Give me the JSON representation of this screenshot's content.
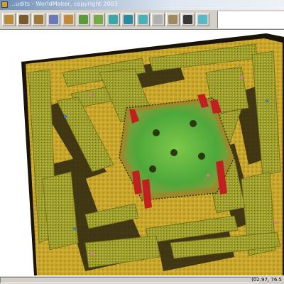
{
  "window": {
    "title": "...udits - WorldMaker, copyright 2003"
  },
  "toolbar": {
    "tools": [
      {
        "icon": "terrain-raise-icon",
        "color": "#b88a3a"
      },
      {
        "icon": "terrain-lower-icon",
        "color": "#7a5a2a"
      },
      {
        "icon": "terrain-smooth-icon",
        "color": "#a07838"
      },
      {
        "icon": "texture-paint-icon",
        "color": "#6a7ab8"
      },
      {
        "icon": "texture-blend-icon",
        "color": "#c08a3a"
      },
      {
        "icon": "grass-icon",
        "color": "#5a9a3a"
      },
      {
        "icon": "grass-large-icon",
        "color": "#78a848"
      },
      {
        "icon": "water-icon",
        "color": "#3aa8a8"
      },
      {
        "icon": "flag-icon",
        "color": "#2a8aa0"
      },
      {
        "icon": "fog-icon",
        "color": "#4ab0b8"
      },
      {
        "icon": "lighting-icon",
        "color": "#b0b0b0"
      },
      {
        "icon": "objects-icon",
        "color": "#a08860"
      },
      {
        "icon": "sphere-icon",
        "color": "#3a3a3a"
      },
      {
        "icon": "sky-icon",
        "color": "#58b8c8"
      }
    ]
  },
  "viewport": {
    "colors": {
      "terrain": "#c9a82a",
      "maze_wall": "#9a9a2a",
      "shadow": "#2a2410",
      "grass": "#4ea83a",
      "banner": "#c02020",
      "fence": "#3a2a10",
      "background": "#ffffff",
      "map_edge": "#1a1408"
    }
  },
  "statusbar": {
    "coords": "(02.97, 76.5"
  }
}
